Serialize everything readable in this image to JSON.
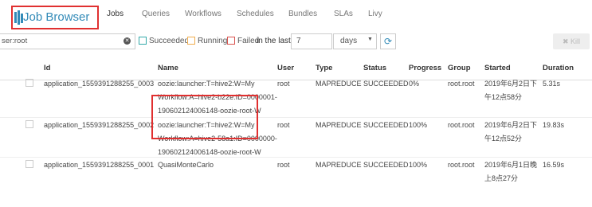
{
  "app": {
    "title": "Job Browser",
    "tabs": [
      "Jobs",
      "Queries",
      "Workflows",
      "Schedules",
      "Bundles",
      "SLAs",
      "Livy"
    ]
  },
  "filters": {
    "user_value": "ser:root",
    "status_succeeded": "Succeeded",
    "status_running": "Running",
    "status_failed": "Failed",
    "in_the_last": "in the last",
    "days_value": "7",
    "days_unit": "days",
    "kill_label": "✖ Kill"
  },
  "table": {
    "columns": [
      "Id",
      "Name",
      "User",
      "Type",
      "Status",
      "Progress",
      "Group",
      "Started",
      "Duration"
    ],
    "rows": [
      {
        "id": "application_1559391288255_0003",
        "name": [
          "oozie:launcher:T=hive2:W=My",
          "Workflow:A=hive2-b22e:ID=0000001-",
          "190602124006148-oozie-root-W"
        ],
        "user": "root",
        "type": "MAPREDUCE",
        "status": "SUCCEEDED",
        "progress": "0%",
        "group": "root.root",
        "started": [
          "2019年6月2日下",
          "午12点58分"
        ],
        "duration": "5.31s"
      },
      {
        "id": "application_1559391288255_0002",
        "name": [
          "oozie:launcher:T=hive2:W=My",
          "Workflow:A=hive2-58a1:ID=0000000-",
          "190602124006148-oozie-root-W"
        ],
        "user": "root",
        "type": "MAPREDUCE",
        "status": "SUCCEEDED",
        "progress": "100%",
        "group": "root.root",
        "started": [
          "2019年6月2日下",
          "午12点52分"
        ],
        "duration": "19.83s"
      },
      {
        "id": "application_1559391288255_0001",
        "name": [
          "QuasiMonteCarlo"
        ],
        "user": "root",
        "type": "MAPREDUCE",
        "status": "SUCCEEDED",
        "progress": "100%",
        "group": "root.root",
        "started": [
          "2019年6月1日晚",
          "上8点27分"
        ],
        "duration": "16.59s"
      }
    ]
  },
  "colors": {
    "brand": "#338bb8",
    "highlight": "#e03030"
  }
}
